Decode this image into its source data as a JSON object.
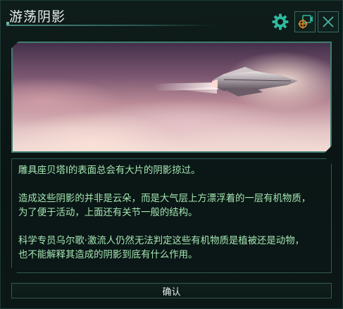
{
  "dialog": {
    "title": "游荡阴影",
    "icons": {
      "settings": "gear-icon",
      "record": "camera-target-icon",
      "close": "close-icon"
    },
    "image": {
      "subject": "spaceship-above-clouds"
    },
    "body": {
      "paragraph_1": "雕具座贝塔I的表面总会有大片的阴影掠过。",
      "paragraph_2_line_1": "造成这些阴影的并非是云朵，而是大气层上方漂浮着的一层有机物质，",
      "paragraph_2_line_2": "为了便于活动，上面还有关节一般的结构。",
      "paragraph_3_line_1": "科学专员乌尔歌·激流人仍然无法判定这些有机物质是植被还是动物，",
      "paragraph_3_line_2": "也不能解释其造成的阴影到底有什么作用。"
    },
    "confirm_label": "确认"
  },
  "colors": {
    "accent": "#3f7d72",
    "text_green": "#a6e6b3",
    "gear_teal": "#2fb79c",
    "target_orange": "#e08a2a"
  }
}
